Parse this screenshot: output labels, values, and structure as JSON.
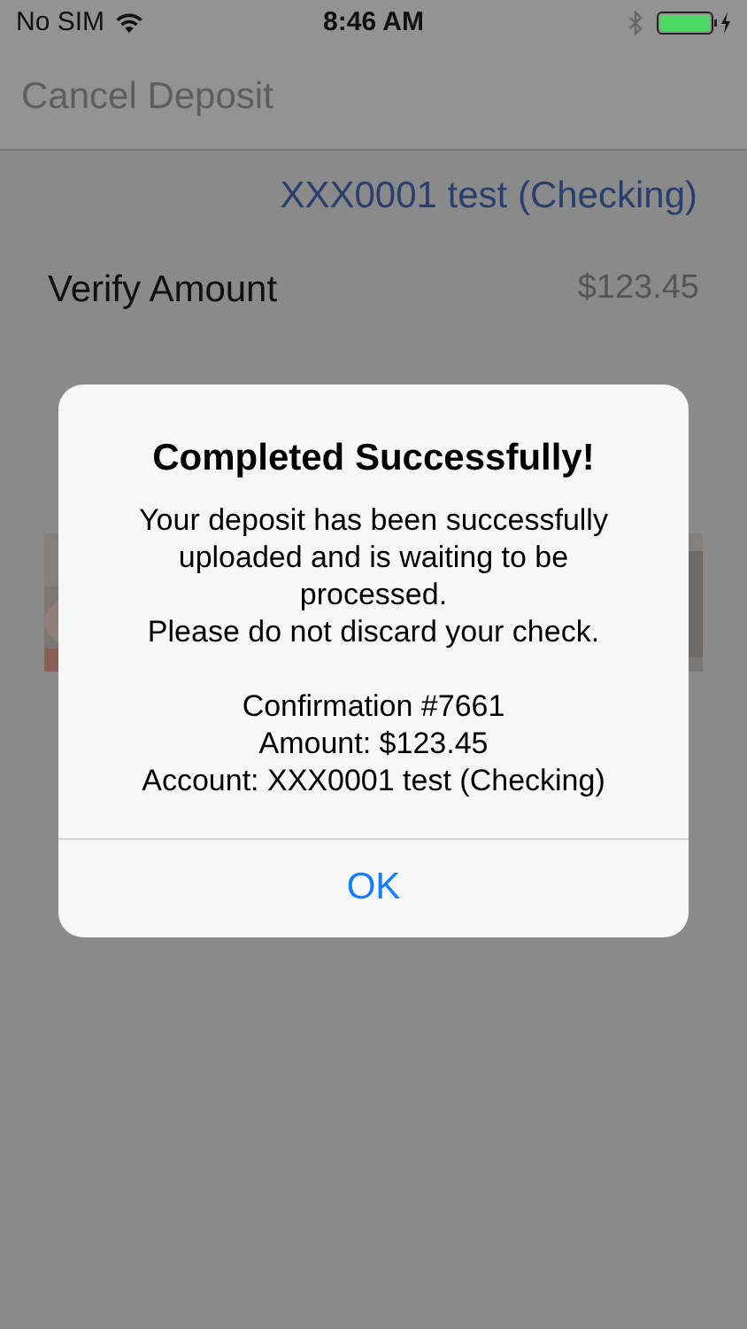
{
  "status_bar": {
    "carrier": "No SIM",
    "time": "8:46 AM"
  },
  "nav_bar": {
    "back": "Cancel Deposit"
  },
  "account": "XXX0001 test (Checking)",
  "rows": [
    {
      "label": "Verify Amount",
      "value": "$123.45"
    }
  ],
  "dialog": {
    "title": "Completed Successfully!",
    "message": [
      "Your deposit has been successfully uploaded and is waiting to be processed.",
      "Please do not discard your check."
    ],
    "details": [
      "Confirmation #7661",
      "Amount: $123.45",
      "Account: XXX0001 test (Checking)"
    ],
    "button": "OK"
  }
}
